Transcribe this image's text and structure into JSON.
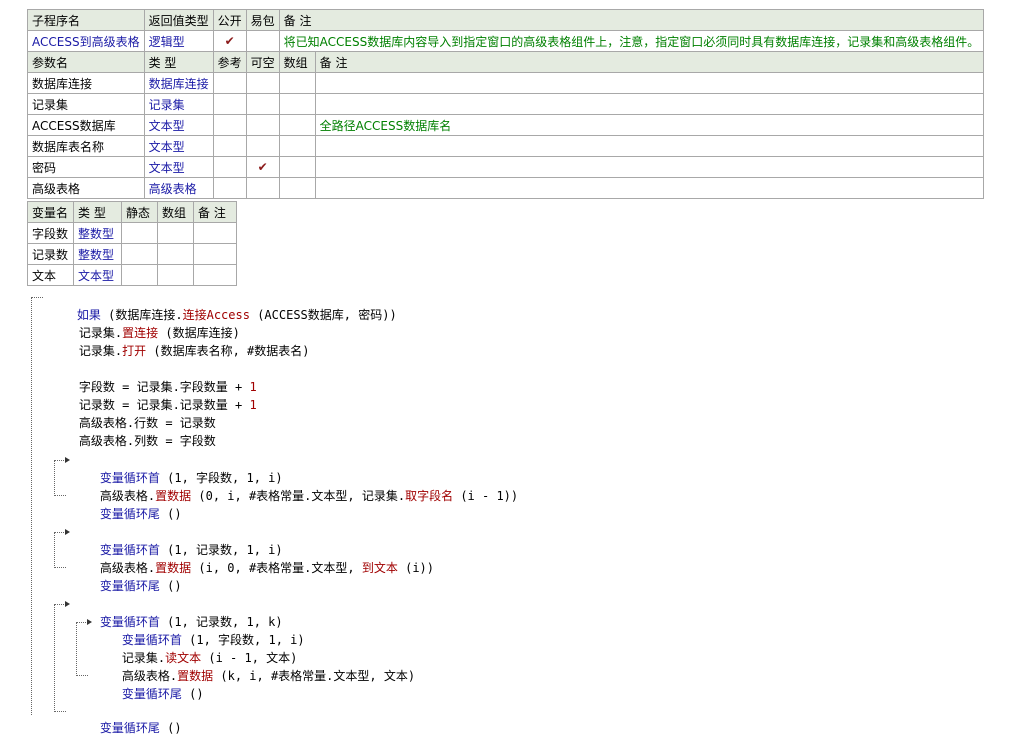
{
  "sub_table": {
    "headers": [
      "子程序名",
      "返回值类型",
      "公开",
      "易包",
      "备 注"
    ],
    "row": {
      "name": "ACCESS到高级表格",
      "return_type": "逻辑型",
      "public": "✔",
      "easy_pkg": "",
      "remark": "将已知ACCESS数据库内容导入到指定窗口的高级表格组件上，注意，指定窗口必须同时具有数据库连接，记录集和高级表格组件。"
    },
    "param_headers": [
      "参数名",
      "类 型",
      "参考",
      "可空",
      "数组",
      "备 注"
    ],
    "params": [
      {
        "name": "数据库连接",
        "type": "数据库连接",
        "ref": "",
        "nullable": "",
        "array": "",
        "remark": ""
      },
      {
        "name": "记录集",
        "type": "记录集",
        "ref": "",
        "nullable": "",
        "array": "",
        "remark": ""
      },
      {
        "name": "ACCESS数据库",
        "type": "文本型",
        "ref": "",
        "nullable": "",
        "array": "",
        "remark": "全路径ACCESS数据库名"
      },
      {
        "name": "数据库表名称",
        "type": "文本型",
        "ref": "",
        "nullable": "",
        "array": "",
        "remark": ""
      },
      {
        "name": "密码",
        "type": "文本型",
        "ref": "",
        "nullable": "✔",
        "array": "",
        "remark": ""
      },
      {
        "name": "高级表格",
        "type": "高级表格",
        "ref": "",
        "nullable": "",
        "array": "",
        "remark": ""
      }
    ]
  },
  "var_table": {
    "headers": [
      "变量名",
      "类 型",
      "静态",
      "数组",
      "备 注"
    ],
    "vars": [
      {
        "name": "字段数",
        "type": "整数型"
      },
      {
        "name": "记录数",
        "type": "整数型"
      },
      {
        "name": "文本",
        "type": "文本型"
      }
    ]
  },
  "code": {
    "l1": {
      "kw": "如果",
      "a": " (数据库连接.",
      "m": "连接Access",
      "b": " (ACCESS数据库, 密码))"
    },
    "l2": {
      "a": "记录集.",
      "m": "置连接",
      "b": " (数据库连接)"
    },
    "l3": {
      "a": "记录集.",
      "m": "打开",
      "b": " (数据库表名称, #数据表名)"
    },
    "l4": {
      "a": "字段数 = 记录集.字段数量 + ",
      "n": "1"
    },
    "l5": {
      "a": "记录数 = 记录集.记录数量 + ",
      "n": "1"
    },
    "l6": {
      "a": "高级表格.行数 = 记录数"
    },
    "l7": {
      "a": "高级表格.列数 = 字段数"
    },
    "l8": {
      "kw": "变量循环首",
      "a": " (1, 字段数, 1, i)"
    },
    "l9": {
      "a": "高级表格.",
      "m": "置数据",
      "b": " (0, i, #表格常量.文本型, 记录集.",
      "m2": "取字段名",
      "c": " (i - 1))"
    },
    "l10": {
      "kw": "变量循环尾",
      "a": " ()"
    },
    "l11": {
      "kw": "变量循环首",
      "a": " (1, 记录数, 1, i)"
    },
    "l12": {
      "a": "高级表格.",
      "m": "置数据",
      "b": " (i, 0, #表格常量.文本型, ",
      "m2": "到文本",
      "c": " (i))"
    },
    "l13": {
      "kw": "变量循环尾",
      "a": " ()"
    },
    "l14": {
      "kw": "变量循环首",
      "a": " (1, 记录数, 1, k)"
    },
    "l15": {
      "kw": "变量循环首",
      "a": " (1, 字段数, 1, i)"
    },
    "l16": {
      "a": "记录集.",
      "m": "读文本",
      "b": " (i - 1, 文本)"
    },
    "l17": {
      "a": "高级表格.",
      "m": "置数据",
      "b": " (k, i, #表格常量.文本型, 文本)"
    },
    "l18": {
      "kw": "变量循环尾",
      "a": " ()"
    },
    "l19": {
      "kw": "变量循环尾",
      "a": " ()"
    }
  }
}
